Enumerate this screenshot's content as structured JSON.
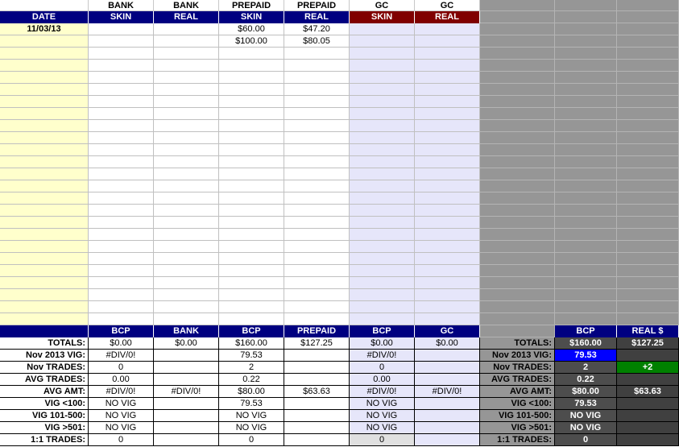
{
  "top_headers": [
    "",
    "BANK",
    "BANK",
    "PREPAID",
    "PREPAID",
    "GC",
    "GC"
  ],
  "sub_headers": [
    "DATE",
    "SKIN",
    "REAL",
    "SKIN",
    "REAL",
    "SKIN",
    "REAL"
  ],
  "rows": [
    [
      "11/03/13",
      "",
      "",
      "$60.00",
      "$47.20",
      "",
      ""
    ],
    [
      "",
      "",
      "",
      "$100.00",
      "$80.05",
      "",
      ""
    ]
  ],
  "summary_headers": [
    "",
    "BCP",
    "BANK",
    "BCP",
    "PREPAID",
    "BCP",
    "GC"
  ],
  "summary_rows": [
    {
      "label": "TOTALS:",
      "cells": [
        "$0.00",
        "$0.00",
        "$160.00",
        "$127.25",
        "$0.00",
        "$0.00"
      ]
    },
    {
      "label": "Nov 2013 VIG:",
      "cells": [
        "#DIV/0!",
        "",
        "79.53",
        "",
        "#DIV/0!",
        ""
      ]
    },
    {
      "label": "Nov TRADES:",
      "cells": [
        "0",
        "",
        "2",
        "",
        "0",
        ""
      ]
    },
    {
      "label": "AVG TRADES:",
      "cells": [
        "0.00",
        "",
        "0.22",
        "",
        "0.00",
        ""
      ]
    },
    {
      "label": "AVG AMT:",
      "cells": [
        "#DIV/0!",
        "#DIV/0!",
        "$80.00",
        "$63.63",
        "#DIV/0!",
        "#DIV/0!"
      ]
    },
    {
      "label": "VIG <100:",
      "cells": [
        "NO VIG",
        "",
        "79.53",
        "",
        "NO VIG",
        ""
      ]
    },
    {
      "label": "VIG 101-500:",
      "cells": [
        "NO VIG",
        "",
        "NO VIG",
        "",
        "NO VIG",
        ""
      ]
    },
    {
      "label": "VIG >501:",
      "cells": [
        "NO VIG",
        "",
        "NO VIG",
        "",
        "NO VIG",
        ""
      ]
    },
    {
      "label": "1:1 TRADES:",
      "cells": [
        "0",
        "",
        "0",
        "",
        "0",
        ""
      ]
    }
  ],
  "right_headers": [
    "BCP",
    "REAL $"
  ],
  "right_rows": [
    {
      "label": "TOTALS:",
      "cells": [
        "$160.00",
        "$127.25"
      ]
    },
    {
      "label": "Nov 2013 VIG:",
      "cells": [
        "79.53",
        ""
      ]
    },
    {
      "label": "Nov TRADES:",
      "cells": [
        "2",
        "+2"
      ]
    },
    {
      "label": "AVG TRADES:",
      "cells": [
        "0.22",
        ""
      ]
    },
    {
      "label": "AVG AMT:",
      "cells": [
        "$80.00",
        "$63.63"
      ]
    },
    {
      "label": "VIG <100:",
      "cells": [
        "79.53",
        ""
      ]
    },
    {
      "label": "VIG 101-500:",
      "cells": [
        "NO VIG",
        ""
      ]
    },
    {
      "label": "VIG >501:",
      "cells": [
        "NO VIG",
        ""
      ]
    },
    {
      "label": "1:1 TRADES:",
      "cells": [
        "0",
        ""
      ]
    }
  ],
  "colors": {
    "navy": "#000080",
    "maroon": "#800000",
    "yellow": "#ffffcc",
    "lavender": "#e6e6fa",
    "gray": "#969696",
    "blue": "#0000ff",
    "green": "#008000"
  }
}
